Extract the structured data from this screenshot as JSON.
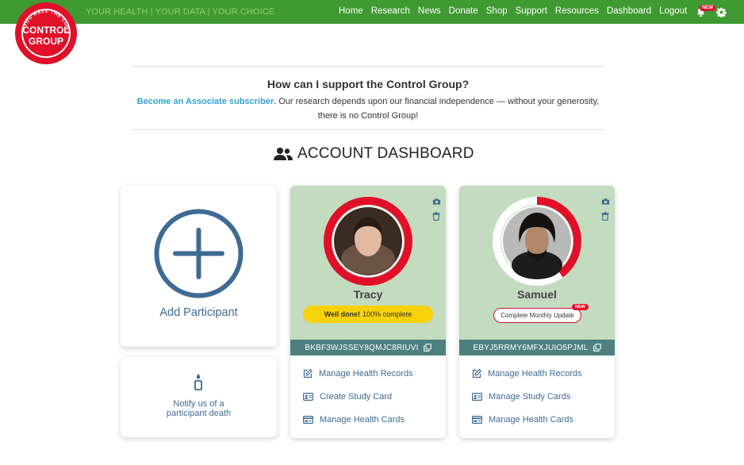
{
  "header": {
    "tagline": "YOUR HEALTH | YOUR DATA | YOUR CHOICE",
    "nav": [
      "Home",
      "Research",
      "News",
      "Donate",
      "Shop",
      "Support",
      "Resources",
      "Dashboard",
      "Logout"
    ],
    "notifications_badge": "NEW",
    "colors": {
      "bar": "#3f9a31",
      "accent": "#e0102a"
    }
  },
  "logo": {
    "text_line1": "CONTROL",
    "text_line2": "GROUP",
    "ring_text": "YOU HAVE THE CONTROL"
  },
  "support": {
    "title": "How can I support the Control Group?",
    "link_text": "Become an Associate subscriber",
    "text": ". Our research depends upon our financial independence — without your generosity, there is no Control Group!"
  },
  "dashboard": {
    "title": "ACCOUNT DASHBOARD",
    "add_participant_label": "Add Participant",
    "death_notice_label_line1": "Notify us of a",
    "death_notice_label_line2": "participant death",
    "participants": [
      {
        "name": "Tracy",
        "code": "BKBF3WJSSEY8QMJC8RIUVI",
        "status_strong": "Well done!",
        "status_text": "100% complete",
        "progress": 1.0,
        "links": [
          "Manage Health Records",
          "Create Study Card",
          "Manage Health Cards"
        ]
      },
      {
        "name": "Samuel",
        "code": "EBYJ5RRMY6MFXJUIO5PJML",
        "status_text": "Complete Monthly Update",
        "status_badge": "NEW",
        "progress": 0.4,
        "links": [
          "Manage Health Records",
          "Manage Study Cards",
          "Manage Health Cards"
        ]
      }
    ]
  }
}
